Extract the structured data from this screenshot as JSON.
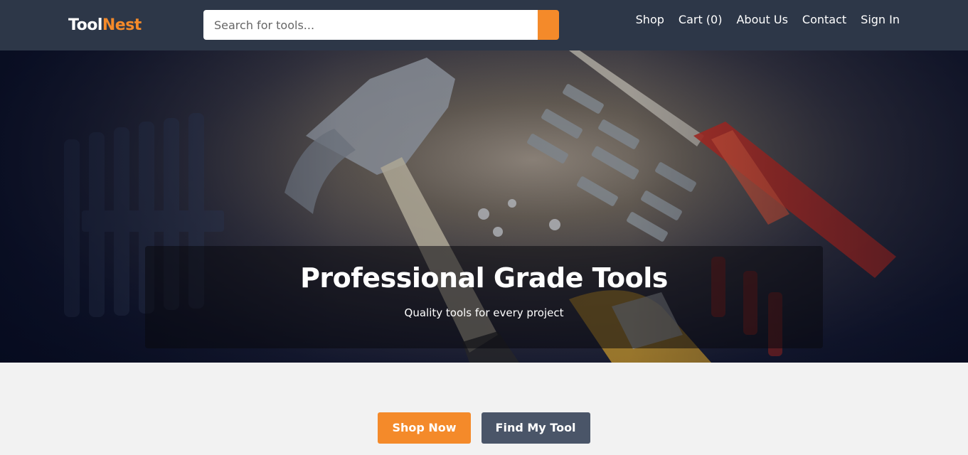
{
  "brand": {
    "part1": "Tool",
    "part2": "Nest"
  },
  "search": {
    "placeholder": "Search for tools..."
  },
  "nav": [
    {
      "label": "Shop"
    },
    {
      "label": "Cart (0)"
    },
    {
      "label": "About Us"
    },
    {
      "label": "Contact"
    },
    {
      "label": "Sign In"
    }
  ],
  "hero": {
    "title": "Professional Grade Tools",
    "subtitle": "Quality tools for every project"
  },
  "cta": {
    "primary_label": "Shop Now",
    "secondary_label": "Find My Tool"
  },
  "colors": {
    "header_bg": "#2d3748",
    "accent": "#f48a2a",
    "secondary_button": "#4a5568",
    "page_bg": "#f2f2f2"
  }
}
